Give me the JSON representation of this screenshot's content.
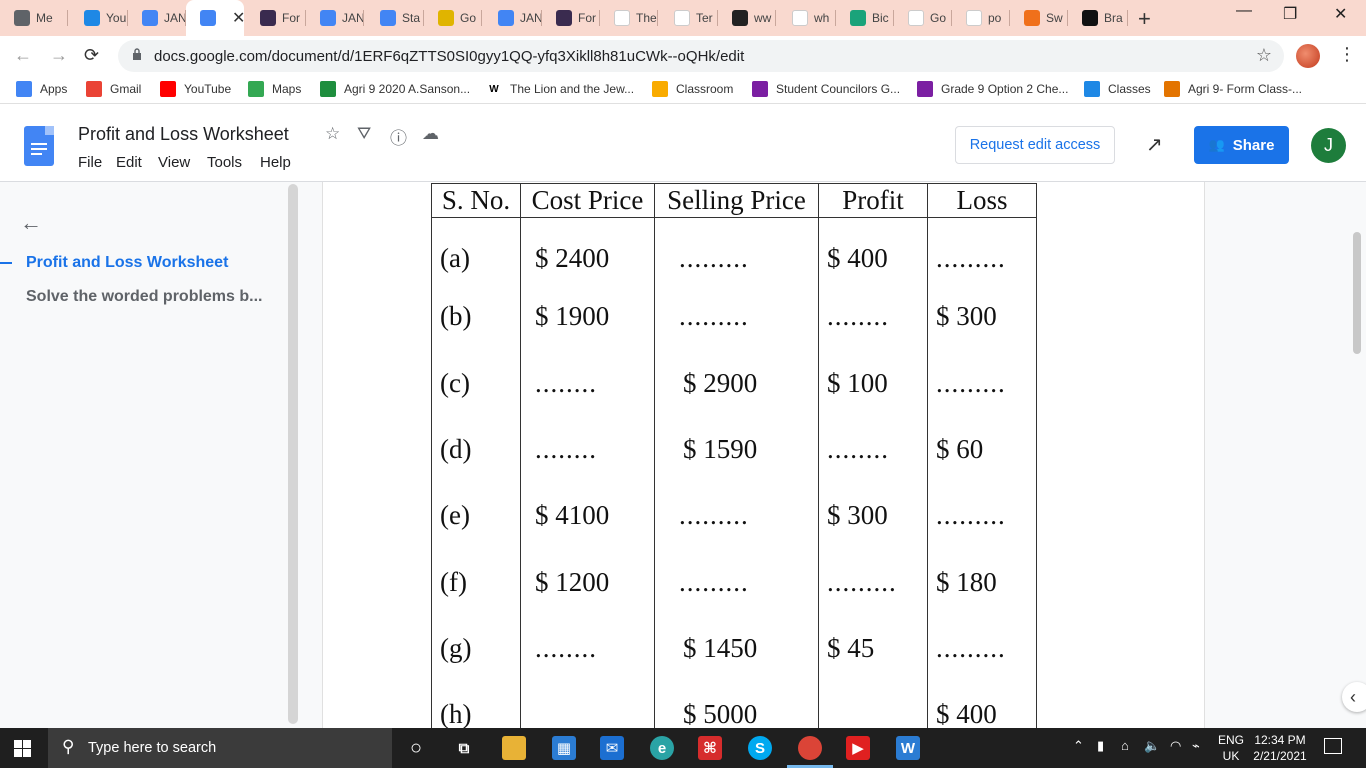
{
  "browser": {
    "tabs": [
      {
        "label": "Me",
        "icon": "tab-favicon",
        "color": "#5f6368"
      },
      {
        "label": "You",
        "icon": "classroom-favicon",
        "color": "#1e88e5"
      },
      {
        "label": "JAN",
        "icon": "docs-favicon",
        "color": "#4285f4"
      },
      {
        "label": "",
        "icon": "docs-favicon",
        "color": "#4285f4",
        "active": true
      },
      {
        "label": "For",
        "icon": "quizlet-favicon",
        "color": "#3a2b4f"
      },
      {
        "label": "JAN",
        "icon": "docs-favicon",
        "color": "#4285f4"
      },
      {
        "label": "Sta",
        "icon": "docs-favicon",
        "color": "#4285f4"
      },
      {
        "label": "Go",
        "icon": "classroom-favicon",
        "color": "#e0b400"
      },
      {
        "label": "JAN",
        "icon": "docs-favicon",
        "color": "#4285f4"
      },
      {
        "label": "For",
        "icon": "quizlet-favicon",
        "color": "#3a2b4f"
      },
      {
        "label": "The",
        "icon": "wikipedia-favicon",
        "color": "#ffffff"
      },
      {
        "label": "Ter",
        "icon": "gmail-favicon",
        "color": "#ffffff"
      },
      {
        "label": "ww",
        "icon": "bbc-favicon",
        "color": "#222222"
      },
      {
        "label": "wh",
        "icon": "google-favicon",
        "color": "#ffffff"
      },
      {
        "label": "Bic",
        "icon": "shield-favicon",
        "color": "#1aa37a"
      },
      {
        "label": "Go",
        "icon": "google-favicon",
        "color": "#ffffff"
      },
      {
        "label": "po",
        "icon": "google-favicon",
        "color": "#ffffff"
      },
      {
        "label": "Sw",
        "icon": "w-favicon",
        "color": "#f0701b"
      },
      {
        "label": "Bra",
        "icon": "b-favicon",
        "color": "#111111"
      }
    ],
    "tab_close": "✕",
    "new_tab": "+",
    "url": "docs.google.com/document/d/1ERF6qZTTS0SI0gyy1QQ-yfq3Xikll8h81uCWk--oQHk/edit"
  },
  "bookmarks": [
    {
      "label": "Apps",
      "icon": "apps-grid-icon",
      "color": "#4285f4"
    },
    {
      "label": "Gmail",
      "icon": "gmail-icon",
      "color": "#ea4335"
    },
    {
      "label": "YouTube",
      "icon": "youtube-icon",
      "color": "#ff0000"
    },
    {
      "label": "Maps",
      "icon": "maps-pin-icon",
      "color": "#34a853"
    },
    {
      "label": "Agri 9 2020 A.Sanson...",
      "icon": "classroom-icon",
      "color": "#1e8e3e"
    },
    {
      "label": "The Lion and the Jew...",
      "icon": "wikipedia-icon",
      "color": "#ffffff"
    },
    {
      "label": "Classroom",
      "icon": "classroom-icon",
      "color": "#f9ab00"
    },
    {
      "label": "Student Councilors G...",
      "icon": "classroom-icon",
      "color": "#7b1fa2"
    },
    {
      "label": "Grade 9 Option 2 Che...",
      "icon": "classroom-icon",
      "color": "#7b1fa2"
    },
    {
      "label": "Classes",
      "icon": "classroom-icon",
      "color": "#1e88e5"
    },
    {
      "label": "Agri 9- Form Class-...",
      "icon": "classroom-icon",
      "color": "#e37400"
    }
  ],
  "docs": {
    "title": "Profit and Loss Worksheet",
    "menu": [
      "File",
      "Edit",
      "View",
      "Tools",
      "Help"
    ],
    "request_edit": "Request edit access",
    "share": "Share",
    "avatar_letter": "J"
  },
  "outline": {
    "heading": "Profit and Loss Worksheet",
    "sub": "Solve the worded problems b..."
  },
  "worksheet": {
    "headers": [
      "S. No.",
      "Cost Price",
      "Selling Price",
      "Profit",
      "Loss"
    ],
    "rows": [
      [
        "(a)",
        "$ 2400",
        ".........",
        "$ 400",
        "........."
      ],
      [
        "(b)",
        "$ 1900",
        ".........",
        "........",
        "$ 300"
      ],
      [
        "(c)",
        "........",
        "$ 2900",
        "$ 100",
        "........."
      ],
      [
        "(d)",
        "........",
        "$ 1590",
        "........",
        "$ 60"
      ],
      [
        "(e)",
        "$ 4100",
        ".........",
        "$ 300",
        "........."
      ],
      [
        "(f)",
        "$ 1200",
        ".........",
        ".........",
        "$ 180"
      ],
      [
        "(g)",
        "........",
        "$ 1450",
        "$ 45",
        "........."
      ],
      [
        "(h)",
        "",
        "$ 5000",
        "",
        "$ 400"
      ]
    ]
  },
  "taskbar": {
    "search_placeholder": "Type here to search",
    "lang": "ENG",
    "region": "UK",
    "time": "12:34 PM",
    "date": "2/21/2021"
  }
}
